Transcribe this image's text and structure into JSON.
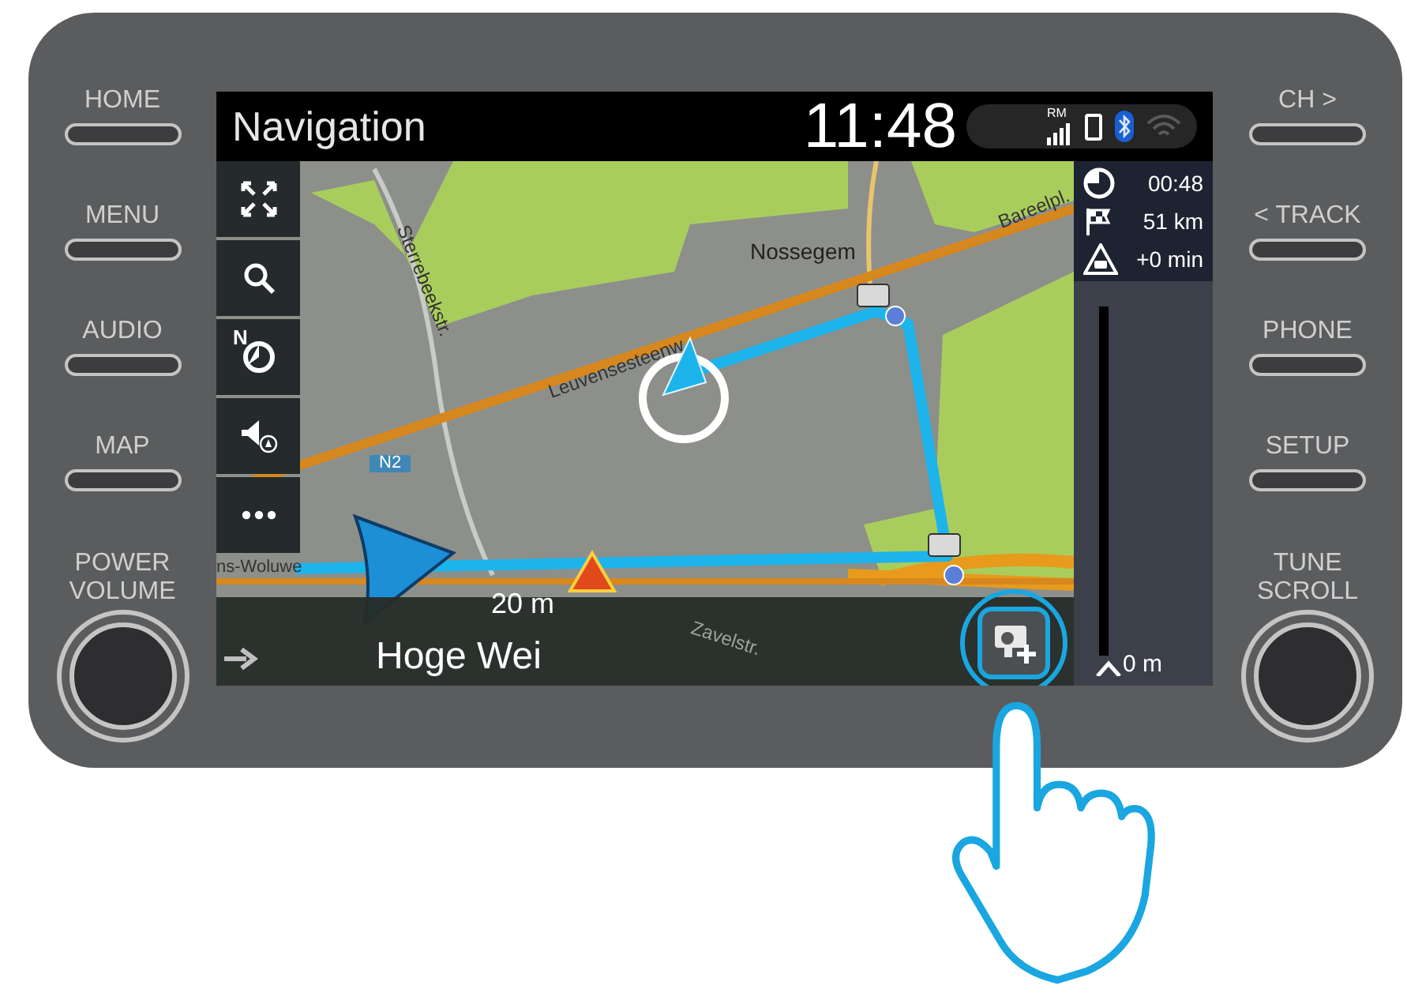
{
  "header": {
    "title": "Navigation",
    "time": "11:48",
    "signal_label": "RM",
    "bluetooth_on": true,
    "wifi_on": false
  },
  "left_buttons": [
    {
      "label": "HOME"
    },
    {
      "label": "MENU"
    },
    {
      "label": "AUDIO"
    },
    {
      "label": "MAP"
    }
  ],
  "left_knob": {
    "label": "POWER VOLUME"
  },
  "right_buttons": [
    {
      "label": "CH >"
    },
    {
      "label": "< TRACK"
    },
    {
      "label": "PHONE"
    },
    {
      "label": "SETUP"
    }
  ],
  "right_knob": {
    "label": "TUNE SCROLL"
  },
  "map_toolbar": [
    {
      "kind": "expand"
    },
    {
      "kind": "search"
    },
    {
      "kind": "north",
      "label": "N"
    },
    {
      "kind": "mute"
    },
    {
      "kind": "more"
    }
  ],
  "map_labels": [
    {
      "text": "Sterrebeekstr."
    },
    {
      "text": "Nossegem"
    },
    {
      "text": "Leuvensesteenw"
    },
    {
      "text": "Bareelpl."
    },
    {
      "text": "N2"
    },
    {
      "text": "ns-Woluwe"
    },
    {
      "text": "Zavelstr."
    }
  ],
  "next_turn": {
    "distance": "20 m",
    "street": "Hoge Wei"
  },
  "trip_info": [
    {
      "kind": "eta",
      "value": "00:48"
    },
    {
      "kind": "distance",
      "value": "51 km"
    },
    {
      "kind": "delay",
      "value": "+0 min"
    }
  ],
  "route_bar": {
    "label": "0 m",
    "level": 1
  }
}
